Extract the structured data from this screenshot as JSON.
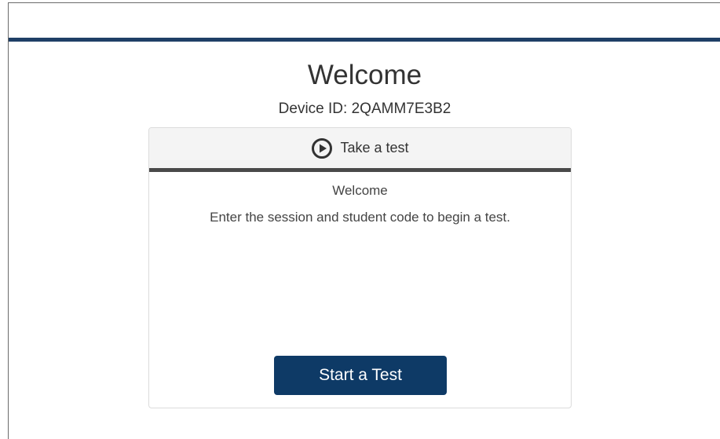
{
  "page": {
    "title": "Welcome",
    "device_id_label": "Device ID:",
    "device_id_value": "2QAMM7E3B2"
  },
  "card": {
    "header_label": "Take a test",
    "header_icon": "play-circle-icon",
    "welcome": "Welcome",
    "instructions": "Enter the session and student code to begin a test.",
    "start_button_label": "Start a Test"
  },
  "colors": {
    "top_bar": "#1f3f66",
    "button_bg": "#0e3a66",
    "header_bg": "#f4f4f4",
    "header_underline": "#4a4a4a"
  }
}
